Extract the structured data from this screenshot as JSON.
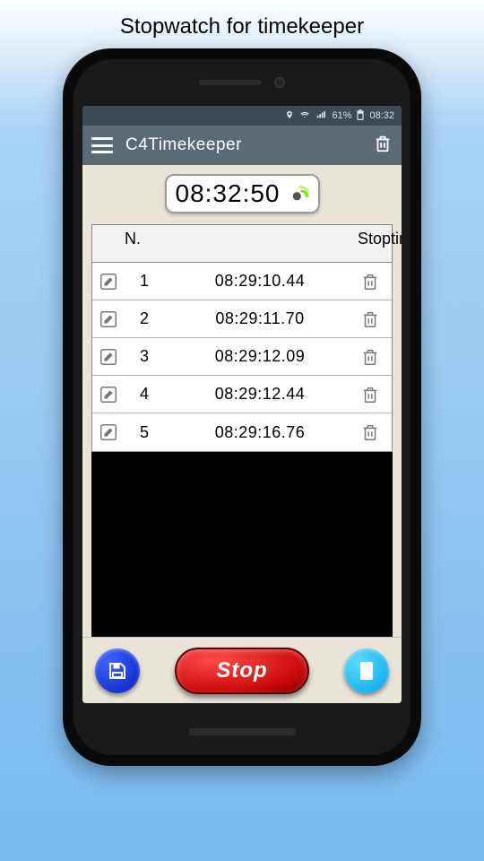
{
  "page_title": "Stopwatch for timekeeper",
  "status": {
    "battery": "61%",
    "time": "08:32"
  },
  "appbar": {
    "title": "C4Timekeeper"
  },
  "clock": "08:32:50",
  "table": {
    "header_n": "N.",
    "header_stop": "Stoptime",
    "rows": [
      {
        "n": "1",
        "time": "08:29:10.44"
      },
      {
        "n": "2",
        "time": "08:29:11.70"
      },
      {
        "n": "3",
        "time": "08:29:12.09"
      },
      {
        "n": "4",
        "time": "08:29:12.44"
      },
      {
        "n": "5",
        "time": "08:29:16.76"
      }
    ]
  },
  "buttons": {
    "stop": "Stop"
  }
}
